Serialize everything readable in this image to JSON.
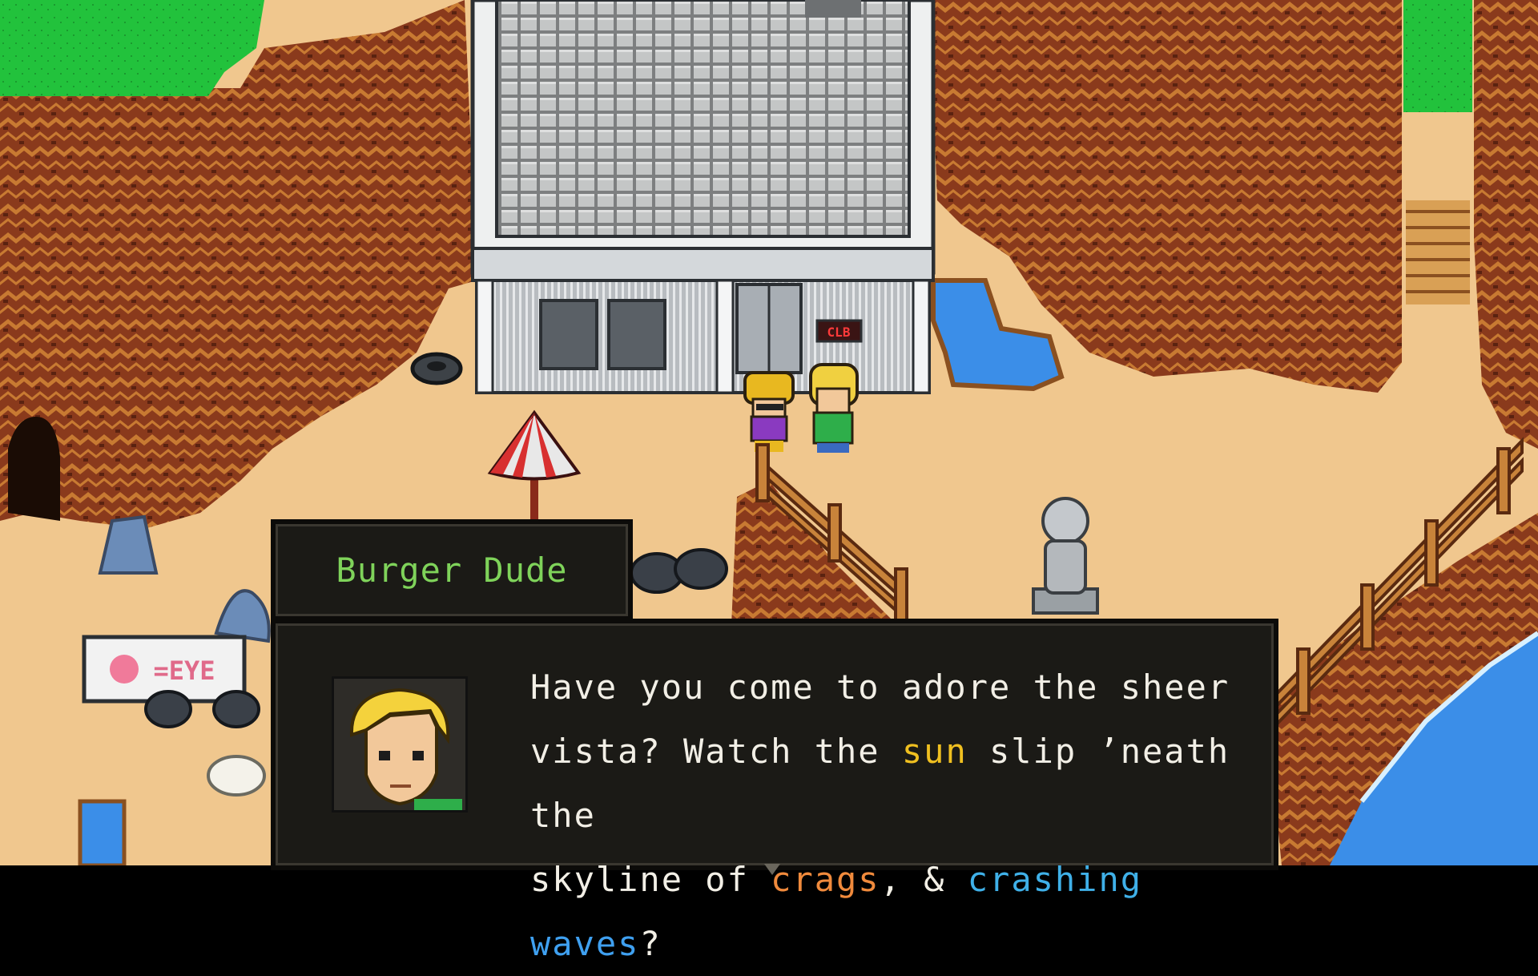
{
  "dialog": {
    "speaker": "Burger Dude",
    "line1": "Have you come to adore the sheer",
    "line2_a": "vista? Watch the ",
    "line2_sun": "sun",
    "line2_b": " slip ’neath the",
    "line3_a": "skyline of ",
    "line3_crags": "crags",
    "line3_b": ", & ",
    "line3_crashing": "crashing",
    "line3_c": " ",
    "line3_waves": "waves",
    "line3_d": "?"
  },
  "building_sign": "CLB",
  "beach_sign": "=EYE",
  "colors": {
    "cliff": "#8a3a1c",
    "sand": "#f0c78e",
    "grass": "#22c23c",
    "water": "#3b8ee8",
    "dialog_bg": "#1b1a16",
    "speaker_name": "#7fd35a",
    "highlight_sun": "#f0c020",
    "highlight_crags": "#f08a3c",
    "highlight_water": "#3fb0e8"
  },
  "icons": [
    "umbrella-icon",
    "statue-icon",
    "tire-icon",
    "trash-bag-icon",
    "rock-icon"
  ]
}
